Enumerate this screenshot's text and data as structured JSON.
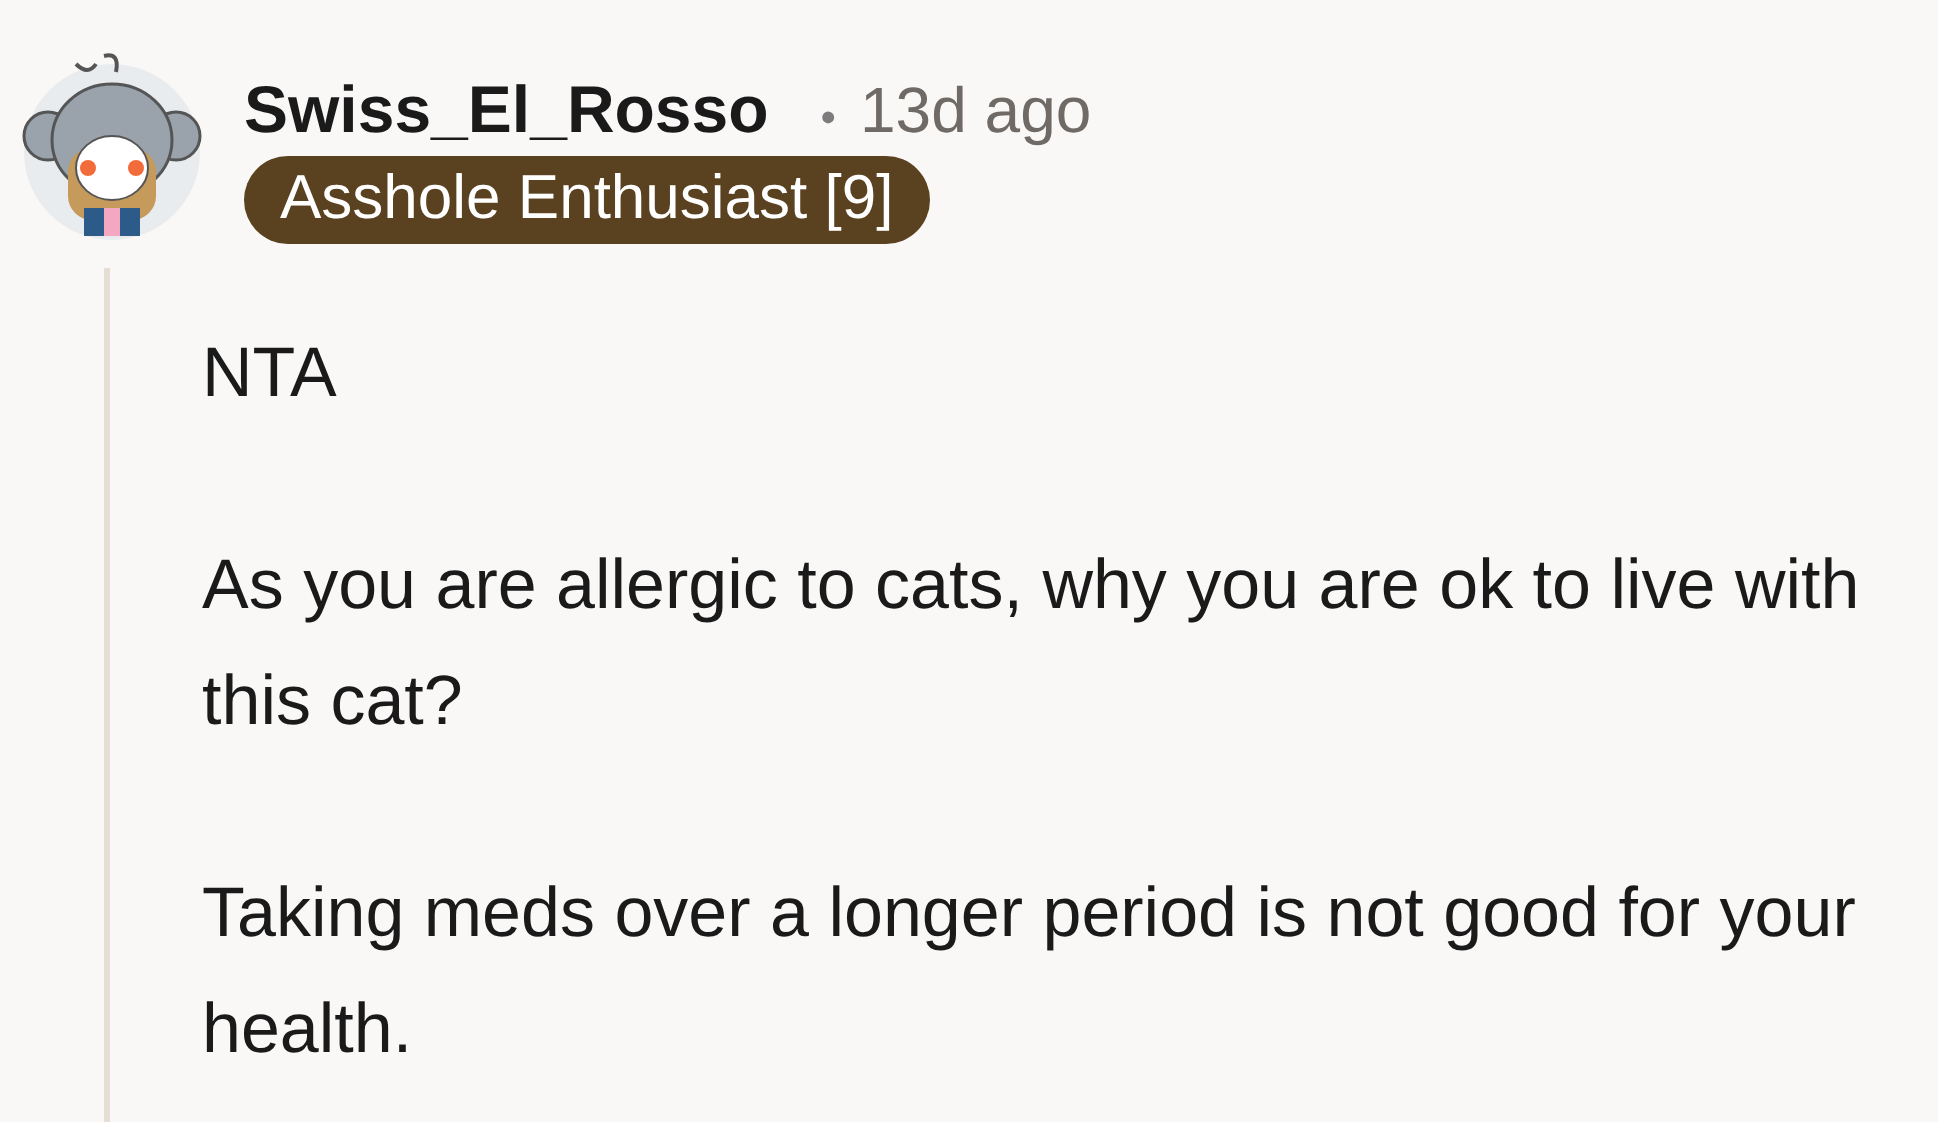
{
  "comment": {
    "author": "Swiss_El_Rosso",
    "separator": "•",
    "time": "13d ago",
    "flair": {
      "text": "Asshole Enthusiast [9]",
      "color": "#5a4120"
    },
    "paragraphs": [
      "NTA",
      "As you are allergic to cats, why you are ok to live with this cat?",
      "Taking meds over a longer period is not good for your health."
    ]
  }
}
